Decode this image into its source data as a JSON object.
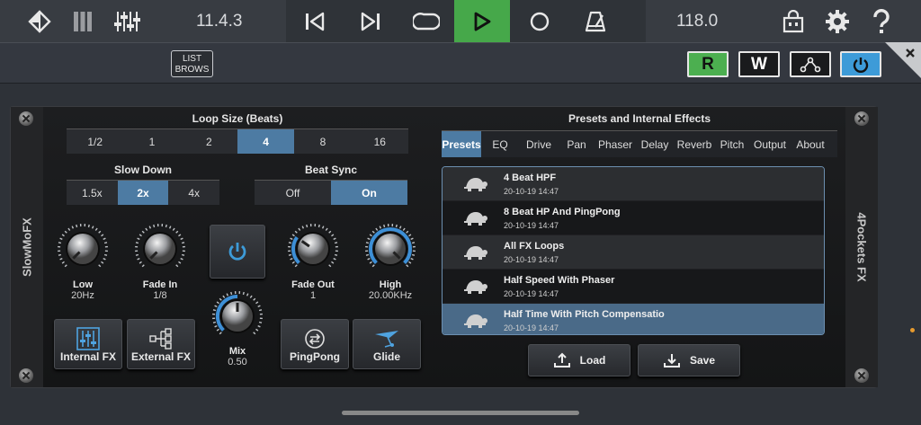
{
  "toolbar": {
    "version": "11.4.3",
    "tempo": "118.0",
    "list_brows": [
      "LIST",
      "BROWS"
    ],
    "toggles": {
      "r": "R",
      "w": "W"
    }
  },
  "plugin": {
    "left_rail_label": "SlowMoFX",
    "right_rail_label": "4Pockets FX",
    "loop_size": {
      "title": "Loop Size (Beats)",
      "options": [
        "1/2",
        "1",
        "2",
        "4",
        "8",
        "16"
      ],
      "selected": "4"
    },
    "slow_down": {
      "title": "Slow Down",
      "options": [
        "1.5x",
        "2x",
        "4x"
      ],
      "selected": "2x"
    },
    "beat_sync": {
      "title": "Beat Sync",
      "options": [
        "Off",
        "On"
      ],
      "selected": "On"
    },
    "knobs": {
      "low": {
        "label": "Low",
        "value": "20Hz"
      },
      "fade_in": {
        "label": "Fade In",
        "value": "1/8"
      },
      "fade_out": {
        "label": "Fade Out",
        "value": "1"
      },
      "high": {
        "label": "High",
        "value": "20.00KHz"
      },
      "mix": {
        "label": "Mix",
        "value": "0.50"
      }
    },
    "buttons": {
      "internal_fx": "Internal FX",
      "external_fx": "External FX",
      "pingpong": "PingPong",
      "glide": "Glide"
    },
    "presets": {
      "title": "Presets and Internal Effects",
      "tabs": [
        "Presets",
        "EQ",
        "Drive",
        "Pan",
        "Phaser",
        "Delay",
        "Reverb",
        "Pitch",
        "Output",
        "About"
      ],
      "selected_tab": "Presets",
      "items": [
        {
          "name": "4 Beat HPF",
          "date": "20-10-19 14:47"
        },
        {
          "name": "8 Beat HP And PingPong",
          "date": "20-10-19 14:47"
        },
        {
          "name": "All FX Loops",
          "date": "20-10-19 14:47"
        },
        {
          "name": "Half Speed With Phaser",
          "date": "20-10-19 14:47"
        },
        {
          "name": "Half Time With Pitch Compensatio",
          "date": "20-10-19 14:47"
        }
      ],
      "load_label": "Load",
      "save_label": "Save"
    }
  },
  "colors": {
    "play_active": "#46a84a",
    "selection": "#4d7ba3",
    "r_toggle": "#4caf50",
    "power_toggle": "#3d9bd8"
  }
}
